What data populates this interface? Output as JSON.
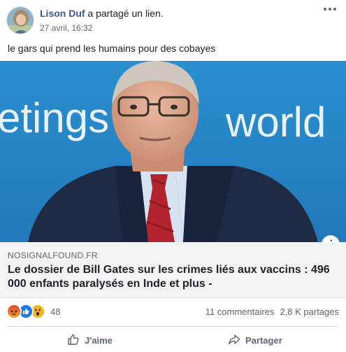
{
  "post": {
    "author": "Lison Duf",
    "action": "a partagé un lien.",
    "timestamp": "27 avril, 16:32",
    "text": "le gars qui prend les humains pour des cobayes"
  },
  "link": {
    "image_background_words": [
      "etings",
      "world"
    ],
    "domain": "NOSIGNALFOUND.FR",
    "title": "Le dossier de Bill Gates sur les crimes liés aux vaccins : 496 000 enfants paralysés en Inde et plus -"
  },
  "reactions": {
    "types": [
      "angry",
      "like",
      "wow"
    ],
    "count": "48"
  },
  "stats": {
    "comments": "11 commentaires",
    "shares": "2,8 K partages"
  },
  "actions": {
    "like_label": "J'aime",
    "share_label": "Partager"
  },
  "icons": {
    "more": "more-horizontal-icon",
    "info": "info-icon",
    "like": "thumbs-up-icon",
    "share": "share-arrow-icon"
  },
  "colors": {
    "author_link": "#385898",
    "secondary_text": "#606770",
    "link_panel_bg": "#f2f3f5",
    "like_blue": "#1877f2",
    "angry_orange": "#e9710f",
    "wow_yellow": "#f7b125"
  }
}
